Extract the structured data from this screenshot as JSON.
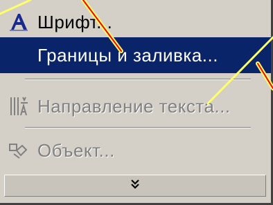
{
  "menu": {
    "items": [
      {
        "label": "Шрифт...",
        "icon": "font-a-icon",
        "state": "normal"
      },
      {
        "label": "Границы и заливка...",
        "icon": "",
        "state": "highlighted"
      },
      {
        "label": "Направление текста...",
        "icon": "text-direction-icon",
        "state": "disabled"
      },
      {
        "label": "Объект...",
        "icon": "object-icon",
        "state": "disabled"
      }
    ],
    "expand": {
      "icon": "double-chevron-down-icon"
    }
  },
  "colors": {
    "menu_bg": "#d4d0c8",
    "highlight_bg": "#0a246a",
    "disabled_text": "#808080",
    "callout_yellow": "#ffff66",
    "callout_red": "#ff0000"
  }
}
